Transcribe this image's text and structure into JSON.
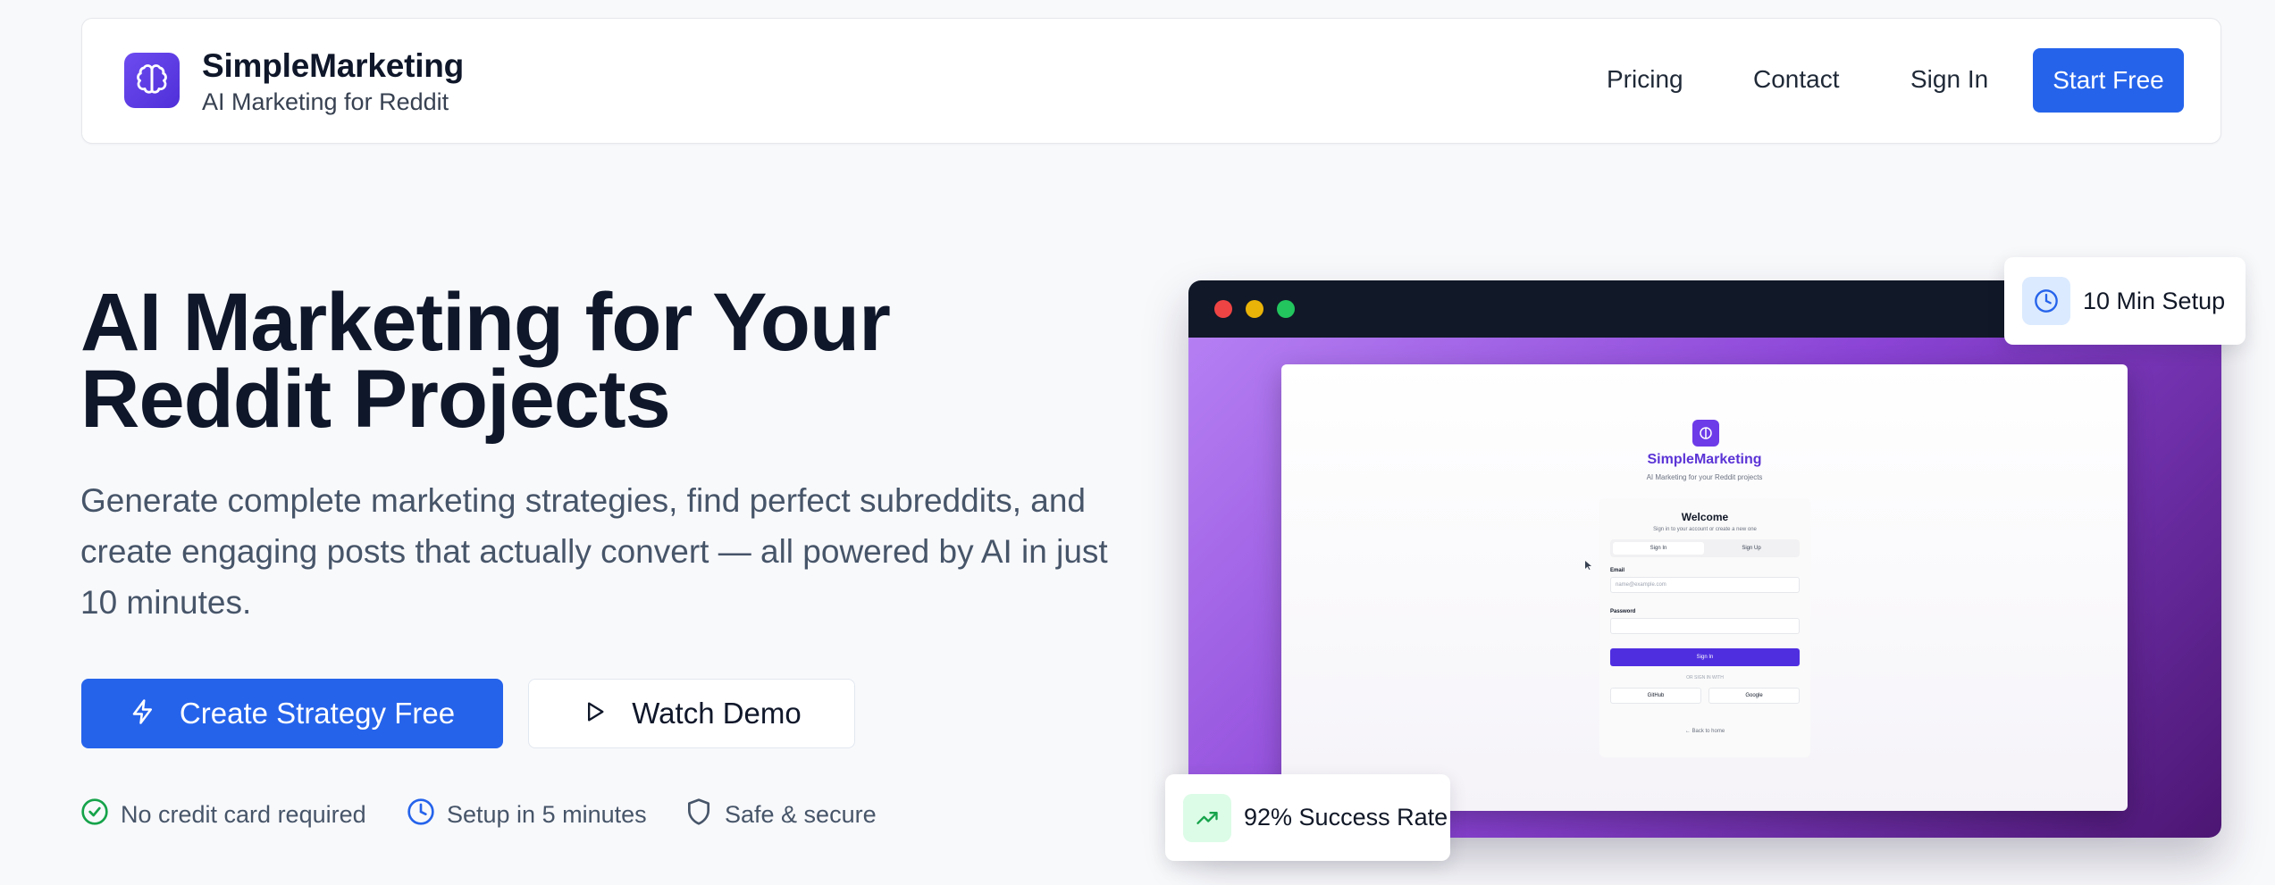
{
  "brand": {
    "name": "SimpleMarketing",
    "tagline": "AI Marketing for Reddit"
  },
  "nav": {
    "pricing": "Pricing",
    "contact": "Contact",
    "sign_in": "Sign In",
    "start_free": "Start Free"
  },
  "hero": {
    "title_line1": "AI Marketing for Your",
    "title_line2": "Reddit Projects",
    "subtitle": "Generate complete marketing strategies, find perfect subreddits, and create engaging posts that actually convert — all powered by AI in just 10 minutes.",
    "cta_primary": "Create Strategy Free",
    "cta_secondary": "Watch Demo"
  },
  "features": [
    {
      "label": "No credit card required",
      "icon": "check-circle-icon"
    },
    {
      "label": "Setup in 5 minutes",
      "icon": "clock-icon"
    },
    {
      "label": "Safe & secure",
      "icon": "shield-icon"
    }
  ],
  "mockup": {
    "brand": "SimpleMarketing",
    "tagline": "AI Marketing for your Reddit projects",
    "welcome": "Welcome",
    "welcome_sub": "Sign in to your account or create a new one",
    "tab_signin": "Sign In",
    "tab_signup": "Sign Up",
    "email_label": "Email",
    "email_placeholder": "name@example.com",
    "password_label": "Password",
    "signin_button": "Sign In",
    "or_text": "OR SIGN IN WITH",
    "github": "GitHub",
    "google": "Google",
    "back": "← Back to home"
  },
  "badges": {
    "setup": "10 Min Setup",
    "success": "92% Success Rate"
  },
  "colors": {
    "accent": "#2563eb",
    "brand_purple": "#5b34d6",
    "success_green": "#16a34a"
  }
}
